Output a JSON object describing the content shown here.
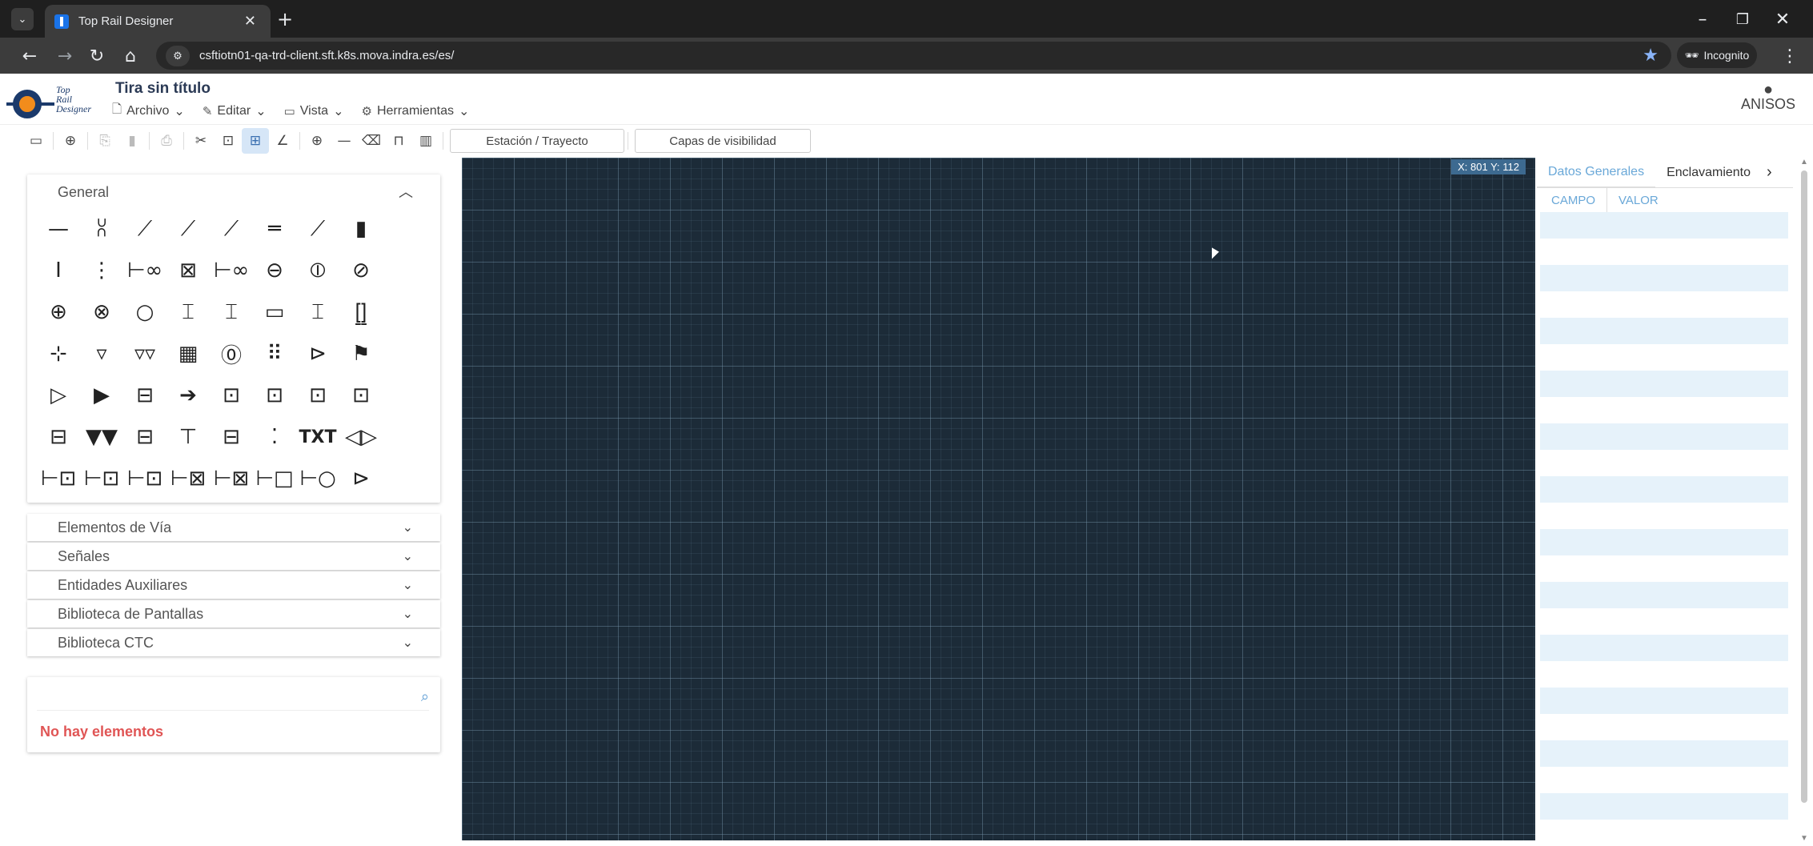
{
  "browser": {
    "tab_title": "Top Rail Designer",
    "url": "csftiotn01-qa-trd-client.sft.k8s.mova.indra.es/es/",
    "incognito_label": "Incognito"
  },
  "app": {
    "logo_text": [
      "Top",
      "Rail",
      "Designer"
    ],
    "doc_title": "Tira sin título",
    "menu": [
      "Archivo",
      "Editar",
      "Vista",
      "Herramientas"
    ],
    "user": "ANISOS"
  },
  "toolbar": {
    "station_btn": "Estación / Trayecto",
    "layers_btn": "Capas de visibilidad"
  },
  "left": {
    "general_title": "General",
    "palette": [
      "—",
      "⩆",
      "⟋",
      "⟋",
      "⟋",
      "═",
      "⟋",
      "▮",
      "I",
      "⋮",
      "⊢∞",
      "⊠",
      "⊢∞",
      "⊖",
      "⦶",
      "⊘",
      "⊕",
      "⊗",
      "○",
      "⌶",
      "⌶",
      "▭",
      "⌶",
      "⦋⦌",
      "⊹",
      "▿",
      "▿▿",
      "▦",
      "⓪",
      "⠿",
      "⊳",
      "⚑",
      "▷",
      "▶",
      "⊟",
      "➔",
      "⊡",
      "⊡",
      "⊡",
      "⊡",
      "⊟",
      "▼▼",
      "⊟",
      "⊤",
      "⊟",
      "⁚",
      "TXT",
      "◁▷",
      "⊢⊡",
      "⊢⊡",
      "⊢⊡",
      "⊢⊠",
      "⊢⊠",
      "⊢□",
      "⊢○",
      "⊳"
    ],
    "accordions": [
      "Elementos de Vía",
      "Señales",
      "Entidades Auxiliares",
      "Biblioteca de Pantallas",
      "Biblioteca CTC"
    ],
    "no_items": "No hay elementos"
  },
  "canvas": {
    "coords": "X: 801 Y: 112"
  },
  "right": {
    "tabs": [
      "Datos Generales",
      "Enclavamiento"
    ],
    "columns": [
      "CAMPO",
      "VALOR"
    ]
  },
  "colors": {
    "canvas_bg": "#1c2b38",
    "accent": "#6aa8d8",
    "error": "#e05555"
  }
}
